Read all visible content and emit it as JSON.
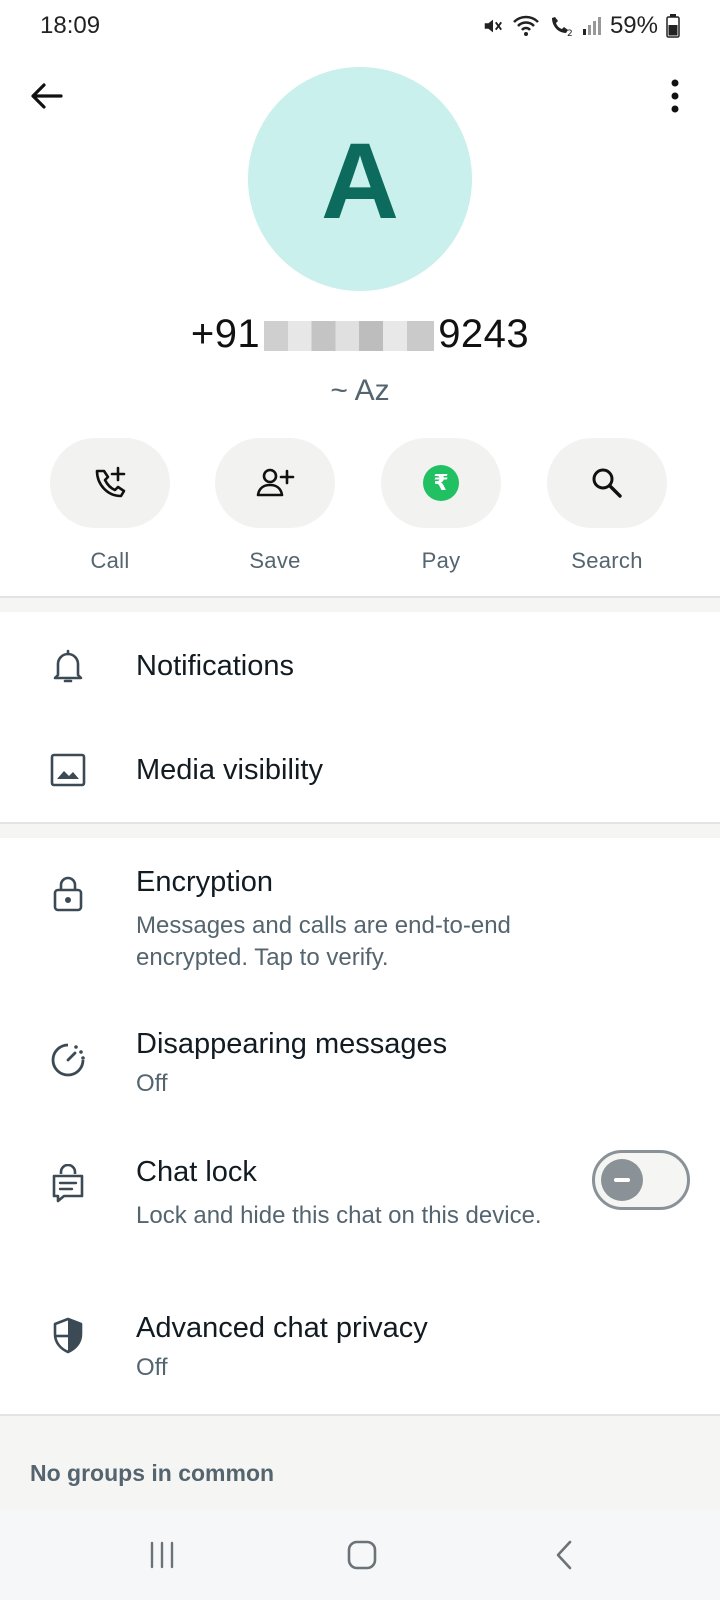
{
  "status_bar": {
    "time": "18:09",
    "battery_percent": "59%",
    "icons": [
      "mute-icon",
      "wifi-icon",
      "wifi-calling-icon",
      "signal-icon",
      "battery-icon"
    ]
  },
  "header": {
    "back_icon": "arrow-left-icon",
    "more_icon": "more-vertical-icon"
  },
  "contact": {
    "avatar_letter": "A",
    "avatar_color": "#c9f0ec",
    "avatar_letter_color": "#0d6b5e",
    "number_prefix": "+91",
    "number_suffix": "9243",
    "alias": "~ Az"
  },
  "actions": [
    {
      "label": "Call",
      "icon": "phone-add-icon"
    },
    {
      "label": "Save",
      "icon": "person-add-icon"
    },
    {
      "label": "Pay",
      "icon": "rupee-icon"
    },
    {
      "label": "Search",
      "icon": "search-icon"
    }
  ],
  "section1": [
    {
      "title": "Notifications",
      "icon": "bell-icon"
    },
    {
      "title": "Media visibility",
      "icon": "image-icon"
    }
  ],
  "section2": [
    {
      "title": "Encryption",
      "subtitle": "Messages and calls are end-to-end encrypted. Tap to verify.",
      "icon": "lock-icon"
    },
    {
      "title": "Disappearing messages",
      "subtitle": "Off",
      "icon": "timer-icon"
    },
    {
      "title": "Chat lock",
      "subtitle": "Lock and hide this chat on this device.",
      "icon": "chat-lock-icon",
      "toggle_on": false
    },
    {
      "title": "Advanced chat privacy",
      "subtitle": "Off",
      "icon": "shield-icon"
    }
  ],
  "groups": {
    "label": "No groups in common"
  },
  "pay_color": "#21c063",
  "pay_symbol": "₹"
}
